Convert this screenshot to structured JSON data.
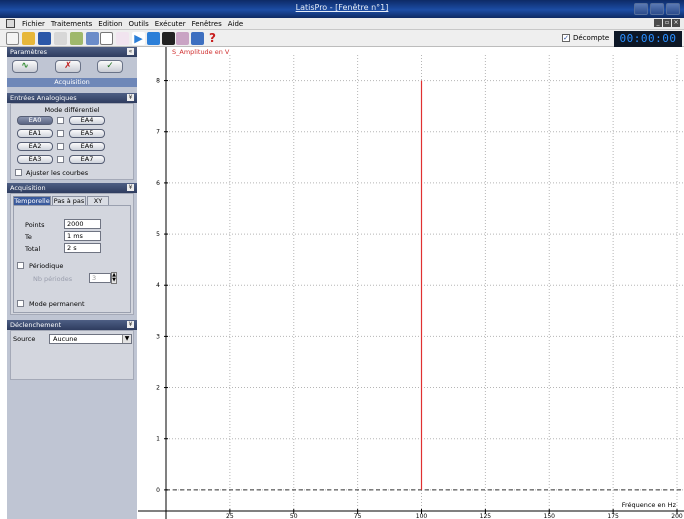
{
  "window": {
    "title": "LatisPro - [Fenêtre n°1]"
  },
  "menu": [
    "Fichier",
    "Traitements",
    "Edition",
    "Outils",
    "Exécuter",
    "Fenêtres",
    "Aide"
  ],
  "toolbar": {
    "icons": [
      "new-icon",
      "open-icon",
      "save-icon",
      "cut-icon",
      "tools-icon",
      "window-icon",
      "curve-icon",
      "model-icon",
      "play-icon",
      "step-icon",
      "stop-icon",
      "record-icon",
      "export-icon",
      "help-icon"
    ],
    "decompte_label": "Décompte",
    "decompte_checked": true,
    "timer": "00:00:00"
  },
  "panel": {
    "title": "Paramètres",
    "acquisition_strip": "Acquisition",
    "entrees": {
      "title": "Entrées Analogiques",
      "mode_label": "Mode différentiel",
      "channels": [
        "EA0",
        "EA1",
        "EA2",
        "EA3",
        "EA4",
        "EA5",
        "EA6",
        "EA7"
      ],
      "selected": "EA0",
      "ajuster_label": "Ajuster les courbes"
    },
    "acquisition": {
      "title": "Acquisition",
      "tabs": [
        "Temporelle",
        "Pas à pas",
        "XY"
      ],
      "active_tab": "Temporelle",
      "points_label": "Points",
      "points_value": "2000",
      "te_label": "Te",
      "te_value": "1 ms",
      "total_label": "Total",
      "total_value": "2 s",
      "periodique_label": "Périodique",
      "nb_periodes_label": "Nb périodes",
      "nb_periodes_value": "3",
      "mode_permanent_label": "Mode permanent"
    },
    "declenchement": {
      "title": "Déclenchement",
      "source_label": "Source",
      "source_value": "Aucune"
    }
  },
  "chart_data": {
    "type": "bar",
    "ylabel": "S_Amplitude en V",
    "xlabel": "Fréquence en Hz",
    "xlim": [
      0,
      200
    ],
    "ylim": [
      -0.1,
      8.5
    ],
    "xticks": [
      25,
      50,
      75,
      100,
      125,
      150,
      175,
      200
    ],
    "yticks": [
      0,
      1,
      2,
      3,
      4,
      5,
      6,
      7,
      8
    ],
    "grid": true,
    "color": "#e03030",
    "x": [
      100
    ],
    "values": [
      8
    ]
  }
}
